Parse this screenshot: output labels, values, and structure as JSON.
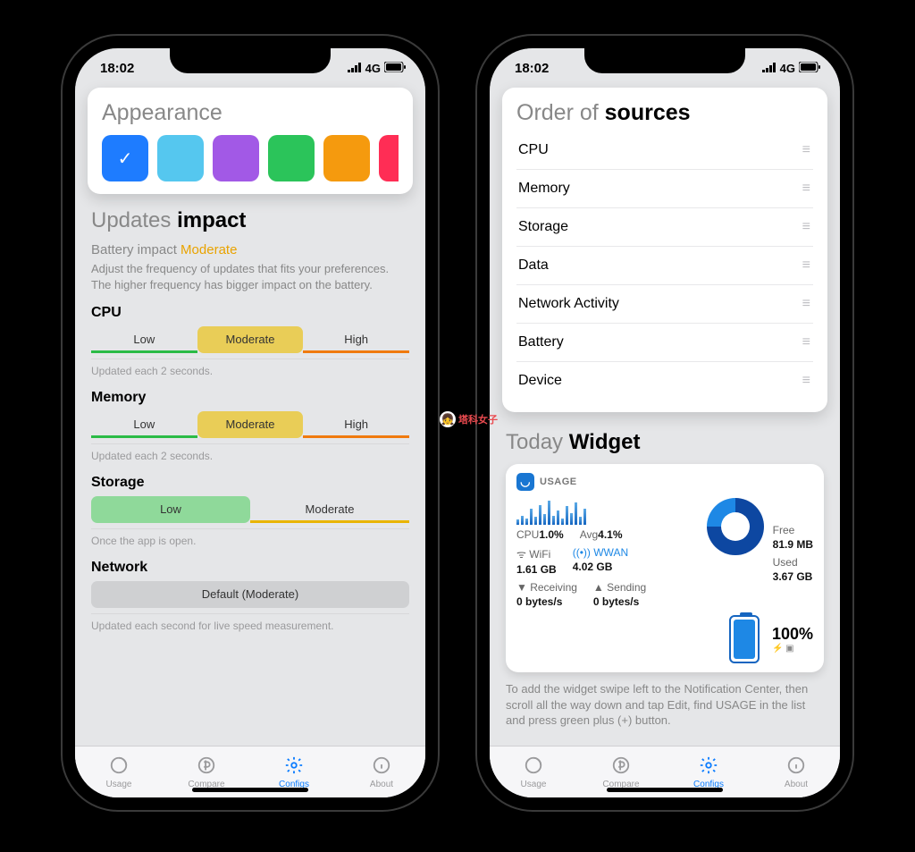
{
  "status": {
    "time": "18:02",
    "net": "4G"
  },
  "left": {
    "appearance": {
      "title_light": "Appearance",
      "colors": [
        "#1e7cff",
        "#55c7ef",
        "#a259e6",
        "#2bc45a",
        "#f59a0e",
        "#ff2d55"
      ],
      "selected_index": 0
    },
    "updates": {
      "title_light": "Updates",
      "title_bold": "impact",
      "impact_label": "Battery impact",
      "impact_value": "Moderate",
      "desc": "Adjust the frequency of updates that fits your preferences. The higher frequency has bigger impact on the battery.",
      "blocks": [
        {
          "name": "CPU",
          "options": [
            "Low",
            "Moderate",
            "High"
          ],
          "selected": 1,
          "hint": "Updated each 2 seconds."
        },
        {
          "name": "Memory",
          "options": [
            "Low",
            "Moderate",
            "High"
          ],
          "selected": 1,
          "hint": "Updated each 2 seconds."
        },
        {
          "name": "Storage",
          "options": [
            "Low",
            "Moderate"
          ],
          "selected": 0,
          "hint": "Once the app is open."
        },
        {
          "name": "Network",
          "options": [
            "Default (Moderate)"
          ],
          "selected": 0,
          "hint": "Updated each second for live speed measurement."
        }
      ]
    }
  },
  "right": {
    "order": {
      "title_light": "Order of",
      "title_bold": "sources",
      "items": [
        "CPU",
        "Memory",
        "Storage",
        "Data",
        "Network Activity",
        "Battery",
        "Device"
      ]
    },
    "widget": {
      "title_light": "Today",
      "title_bold": "Widget",
      "chip": "USAGE",
      "cpu_label": "CPU",
      "cpu_val": "1.0%",
      "avg_label": "Avg",
      "avg_val": "4.1%",
      "wifi_label": "WiFi",
      "wifi_val": "1.61 GB",
      "wwan_label": "WWAN",
      "wwan_val": "4.02 GB",
      "recv_label": "Receiving",
      "recv_val": "0 bytes/s",
      "send_label": "Sending",
      "send_val": "0 bytes/s",
      "free_label": "Free",
      "free_val": "81.9 MB",
      "used_label": "Used",
      "used_val": "3.67 GB",
      "batt": "100%",
      "help": "To add the widget swipe left to the Notification Center, then scroll all the way down and tap Edit, find USAGE in the list and press green plus (+) button."
    }
  },
  "tabs": [
    "Usage",
    "Compare",
    "Configs",
    "About"
  ],
  "active_tab": 2,
  "watermark": "塔科女子"
}
